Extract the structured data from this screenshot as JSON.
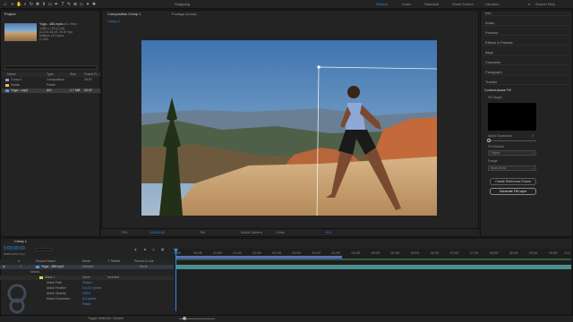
{
  "toolbar": {
    "tools": [
      "home",
      "arrow",
      "hand",
      "zoom",
      "orbit",
      "pan",
      "dolly",
      "rect",
      "pen",
      "text",
      "brush",
      "clone",
      "eraser",
      "roto",
      "puppet"
    ],
    "snapping": "Snapping",
    "workspaces": [
      {
        "label": "Default",
        "active": true
      },
      {
        "label": "Learn"
      },
      {
        "label": "Standard"
      },
      {
        "label": "Small Screen"
      },
      {
        "label": "Libraries"
      }
    ],
    "search_placeholder": "Search Help"
  },
  "project": {
    "tab": "Project",
    "file_name": "Yoga - 480.mp4",
    "file_used": ", used 1 time",
    "file_info1": "1280 x 720 (1.00)",
    "file_info2": "Δ 0;00;16;19, 29.97 fps",
    "file_info3": "Millions of Colors",
    "file_info4": "H.264",
    "search_placeholder": "",
    "columns": [
      "Name",
      "Type",
      "Size",
      "Frame R..."
    ],
    "items": [
      {
        "name": "Comp 1",
        "type": "Composition",
        "size": "",
        "rate": "29.97",
        "color": "#8e8ee0"
      },
      {
        "name": "Solids",
        "type": "Folder",
        "size": "",
        "rate": "",
        "color": "#e6c34a"
      },
      {
        "name": "Yoga ...mp4",
        "type": "AVI",
        "size": "1.7 MB",
        "rate": "29.97",
        "color": "#4a9ad8"
      }
    ]
  },
  "viewer": {
    "tabs": [
      "Composition Comp 1",
      "Footage (none)"
    ],
    "comp_tab": "Comp 1",
    "footer": {
      "zoom": "70%",
      "timecode": "0;00;00;00",
      "res": "Full",
      "camera": "Active Camera",
      "view": "1 View",
      "exposure": "+0.0"
    }
  },
  "right_panel": {
    "items": [
      "Info",
      "Audio",
      "Preview",
      "Effects & Presets",
      "Align",
      "Character",
      "Paragraph",
      "Tracker"
    ],
    "caf": {
      "title": "Content-Aware Fill",
      "fill_target": "Fill Target",
      "alpha_exp": "Alpha Expansion",
      "alpha_val": "0",
      "fill_method": "Fill Method",
      "method_val": "Object",
      "range": "Range",
      "range_val": "Work Area",
      "btn_ref": "Create Reference Frame",
      "btn_gen": "Generate Fill Layer"
    }
  },
  "timeline": {
    "tab": "Comp 1",
    "timecode": "0;00;00;00",
    "fps": "00000 (29.97 fps)",
    "ticks": [
      "0:00f",
      "00:15f",
      "01:00f",
      "01:15f",
      "02:00f",
      "02:15f",
      "03:00f",
      "03:15f",
      "04:00f",
      "04:15f",
      "05:00f",
      "05:15f",
      "06:00f",
      "06:15f",
      "07:00f",
      "07:15f",
      "08:00f",
      "08:15f",
      "09:00f",
      "09:15f",
      "10:0"
    ],
    "columns": [
      "#",
      "Source Name",
      "Mode",
      "T TrkMat",
      "Parent & Link"
    ],
    "layer": {
      "index": "1",
      "name": "Yoga - 480.mp4",
      "mode": "Normal",
      "parent": "None"
    },
    "masks_label": "Masks",
    "mask1": "Mask 1",
    "mask_mode": "None",
    "inverted": "Inverted",
    "props": [
      {
        "name": "Mask Path",
        "value": "Shape..."
      },
      {
        "name": "Mask Feather",
        "value": "0.0,0.0 pixels"
      },
      {
        "name": "Mask Opacity",
        "value": "100%"
      },
      {
        "name": "Mask Expansion",
        "value": "0.0 pixels"
      }
    ],
    "reset": "Reset",
    "footer": "Toggle Switches / Modes"
  },
  "colors": {
    "accent": "#2d8ceb",
    "layer_bar": "#4c8f8f",
    "work_area": "#5c6bbf"
  }
}
